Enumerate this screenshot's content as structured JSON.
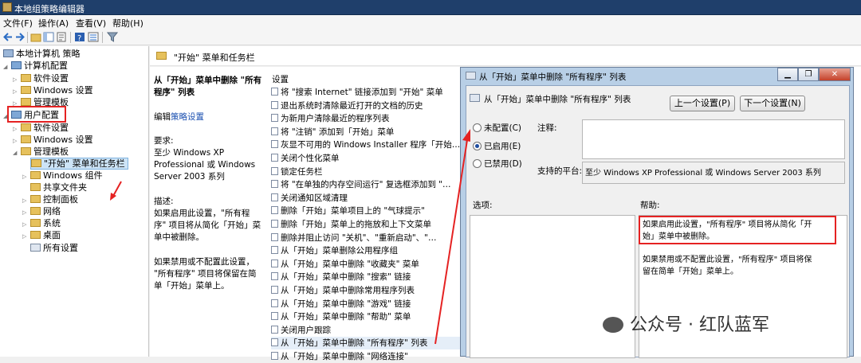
{
  "window": {
    "title": "本地组策略编辑器"
  },
  "menu": [
    "文件(F)",
    "操作(A)",
    "查看(V)",
    "帮助(H)"
  ],
  "tree": {
    "root": "本地计算机 策略",
    "computer_config": "计算机配置",
    "cc_software": "软件设置",
    "cc_windows": "Windows 设置",
    "cc_admin": "管理模板",
    "user_config": "用户配置",
    "uc_software": "软件设置",
    "uc_windows": "Windows 设置",
    "uc_admin": "管理模板",
    "start_menu": "\"开始\" 菜单和任务栏",
    "win_components": "Windows 组件",
    "shared_folders": "共享文件夹",
    "control_panel": "控制面板",
    "network": "网络",
    "system": "系统",
    "desktop": "桌面",
    "all_settings": "所有设置"
  },
  "detail": {
    "header": "\"开始\" 菜单和任务栏",
    "policy_title": "从「开始」菜单中删除 \"所有程序\" 列表",
    "edit_prefix": "编辑",
    "edit_link": "策略设置",
    "req_label": "要求:",
    "req_text_1": "至少 Windows XP",
    "req_text_2": "Professional 或 Windows",
    "req_text_3": "Server 2003 系列",
    "desc_label": "描述:",
    "desc_1": "如果启用此设置，\"所有程",
    "desc_2": "序\" 项目将从简化「开始」菜",
    "desc_3": "单中被删除。",
    "desc_4": "如果禁用或不配置此设置，",
    "desc_5": "\"所有程序\" 项目将保留在简",
    "desc_6": "单「开始」菜单上。",
    "settings_col": "设置"
  },
  "settings": [
    "将 \"搜索 Internet\" 链接添加到 \"开始\" 菜单",
    "退出系统时清除最近打开的文档的历史",
    "为新用户清除最近的程序列表",
    "将 \"注销\" 添加到「开始」菜单",
    "灰显不可用的 Windows Installer 程序「开始…",
    "关闭个性化菜单",
    "锁定任务栏",
    "将 \"在单独的内存空间运行\" 复选框添加到 \"…",
    "关闭通知区域清理",
    "删除「开始」菜单项目上的 \"气球提示\"",
    "删除「开始」菜单上的拖放和上下文菜单",
    "删除并阻止访问 \"关机\"、\"重新启动\"、\"…",
    "从「开始」菜单删除公用程序组",
    "从「开始」菜单中删除 \"收藏夹\" 菜单",
    "从「开始」菜单中删除 \"搜索\" 链接",
    "从「开始」菜单中删除常用程序列表",
    "从「开始」菜单中删除 \"游戏\" 链接",
    "从「开始」菜单中删除 \"帮助\" 菜单",
    "关闭用户跟踪",
    "从「开始」菜单中删除 \"所有程序\" 列表",
    "从「开始」菜单中删除 \"网络连接\""
  ],
  "dialog": {
    "title": "从「开始」菜单中删除 \"所有程序\" 列表",
    "heading": "从「开始」菜单中删除 \"所有程序\" 列表",
    "prev_btn": "上一个设置(P)",
    "next_btn": "下一个设置(N)",
    "not_configured": "未配置(C)",
    "enabled": "已启用(E)",
    "disabled": "已禁用(D)",
    "comment_label": "注释:",
    "platform_label": "支持的平台:",
    "platform_text": "至少 Windows XP Professional 或 Windows Server 2003 系列",
    "options_label": "选项:",
    "help_label": "帮助:",
    "help_1": "如果启用此设置，\"所有程序\" 项目将从简化「开",
    "help_2": "始」菜单中被删除。",
    "help_3": "如果禁用或不配置此设置，\"所有程序\" 项目将保",
    "help_4": "留在简单「开始」菜单上。",
    "btn_minimize": "▁",
    "btn_restore": "❐",
    "btn_close": "✕"
  },
  "watermark": "公众号 · 红队蓝军",
  "colors": {
    "annotation_red": "#e52222",
    "selected_bg": "#cde4f7",
    "link_blue": "#1a4fb0"
  }
}
